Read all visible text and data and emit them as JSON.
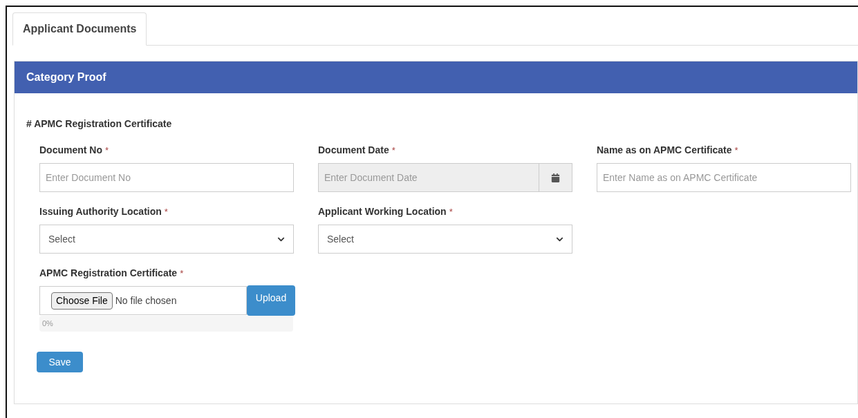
{
  "tabs": [
    {
      "label": "Applicant Documents",
      "selected": true
    }
  ],
  "panel": {
    "title": "Category Proof",
    "section_heading": "# APMC Registration Certificate",
    "rows": [
      [
        {
          "kind": "text",
          "label": "Document No",
          "required_mark": "*",
          "placeholder": "Enter Document No",
          "disabled": false
        },
        {
          "kind": "date",
          "label": "Document Date",
          "required_mark": "*",
          "placeholder": "Enter Document Date",
          "disabled": true
        },
        {
          "kind": "text",
          "label": "Name as on APMC Certificate",
          "required_mark": "*",
          "placeholder": "Enter Name as on APMC Certificate",
          "disabled": false
        }
      ],
      [
        {
          "kind": "select",
          "label": "Issuing Authority Location",
          "required_mark": "*",
          "value": "Select"
        },
        {
          "kind": "select",
          "label": "Applicant Working Location",
          "required_mark": "*",
          "value": "Select"
        }
      ],
      [
        {
          "kind": "file",
          "label": "APMC Registration Certificate",
          "required_mark": "*",
          "choose_label": "Choose File",
          "file_status": "No file chosen",
          "upload_label": "Upload",
          "progress": {
            "level": 0,
            "reading": "0%"
          }
        }
      ]
    ],
    "save_label": "Save"
  }
}
